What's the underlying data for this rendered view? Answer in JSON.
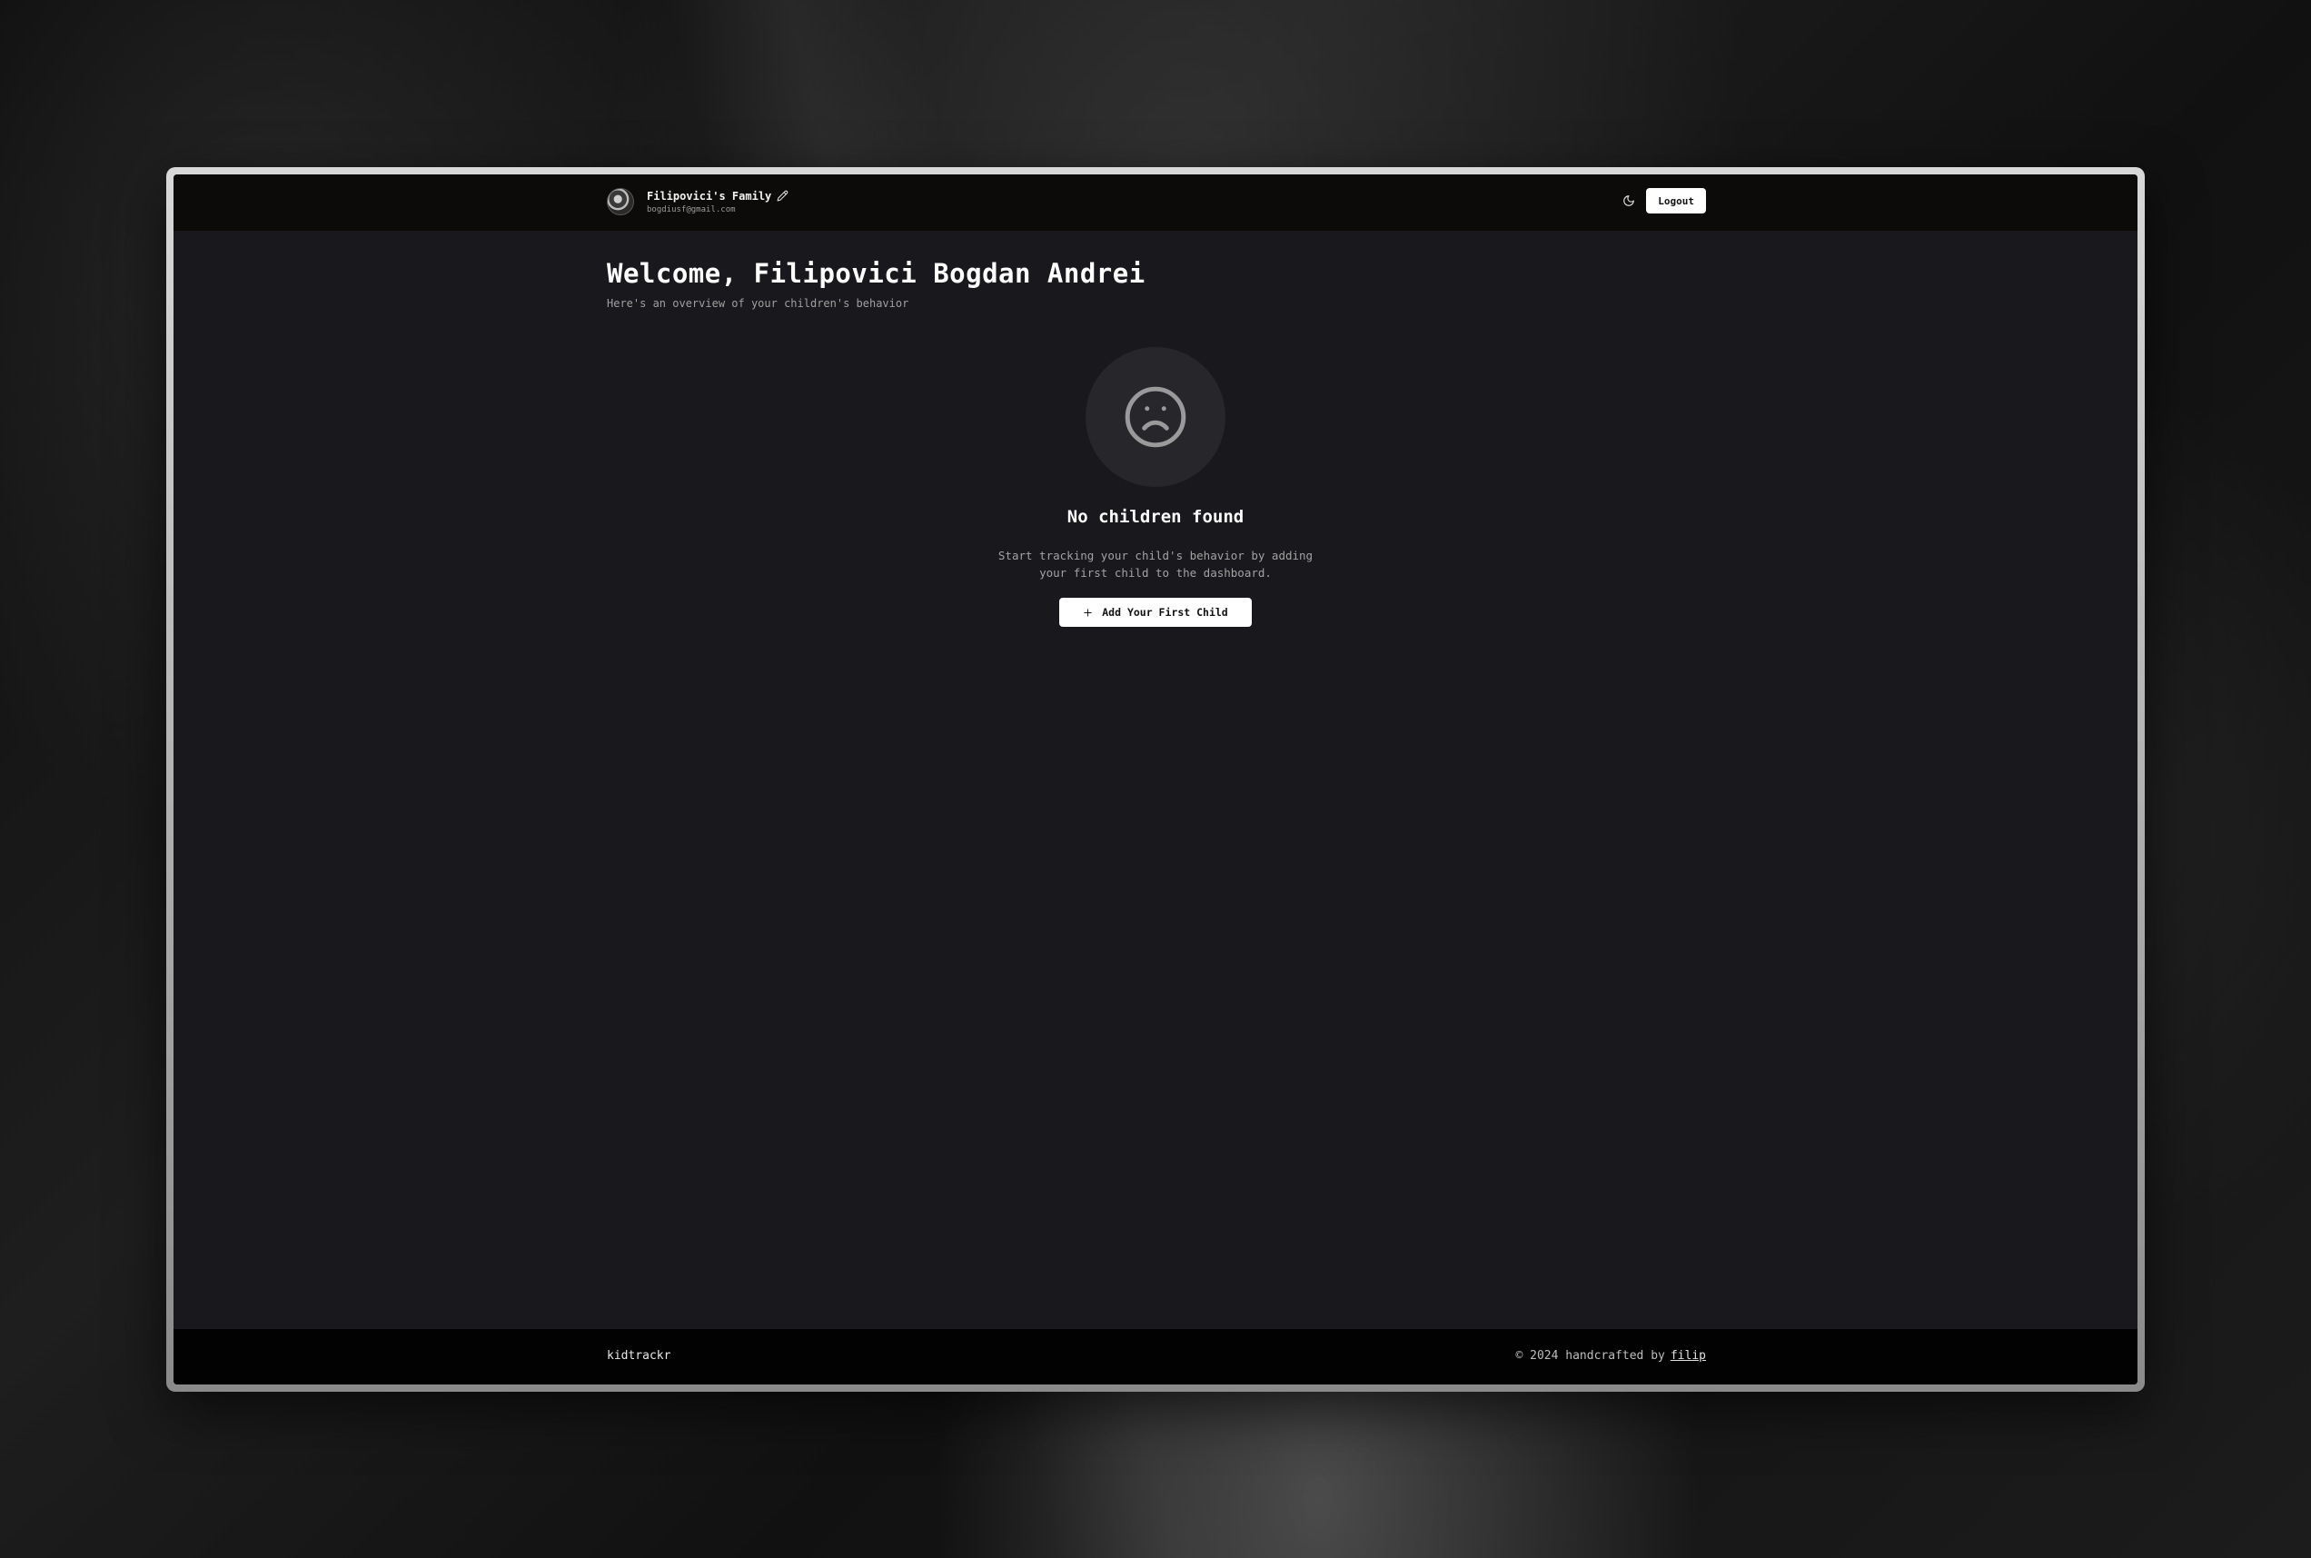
{
  "header": {
    "family_name": "Filipovici's Family",
    "email": "bogdiusf@gmail.com",
    "logout_label": "Logout"
  },
  "main": {
    "welcome": "Welcome, Filipovici Bogdan Andrei",
    "subtitle": "Here's an overview of your children's behavior",
    "empty_state": {
      "title": "No children found",
      "description": "Start tracking your child's behavior by adding your first child to the dashboard.",
      "button_label": "Add Your First Child"
    }
  },
  "footer": {
    "brand": "kidtrackr",
    "credit_prefix": "© 2024 handcrafted by",
    "credit_link": "filip"
  },
  "icons": {
    "edit": "pencil-icon",
    "theme": "moon-icon",
    "empty": "sad-face-icon",
    "add": "plus-icon"
  },
  "colors": {
    "topbar": "#0c0b09",
    "background": "#18181d",
    "footer": "#020202",
    "button": "#ffffff"
  }
}
